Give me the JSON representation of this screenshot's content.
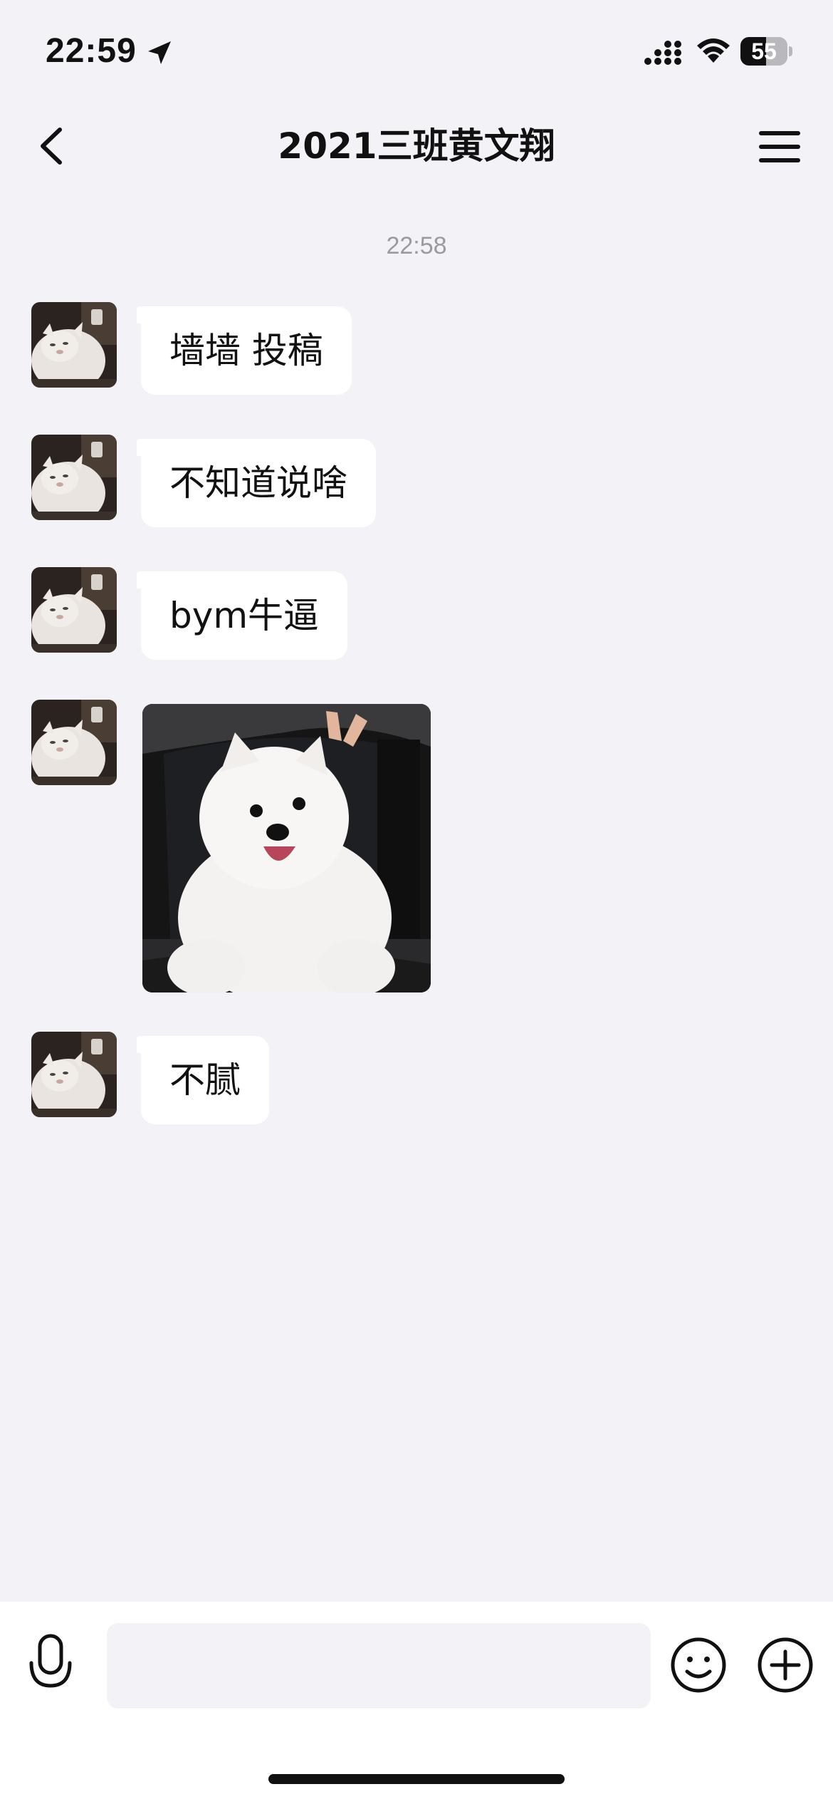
{
  "status_bar": {
    "time": "22:59",
    "battery_percent": 55,
    "battery_label": "55",
    "icons": [
      "location-arrow-icon",
      "cellular-signal-icon",
      "wifi-icon",
      "battery-icon"
    ]
  },
  "nav": {
    "title": "2021三班黄文翔",
    "back_icon": "chevron-left-icon",
    "menu_icon": "hamburger-menu-icon"
  },
  "conversation": {
    "timestamp": "22:58",
    "messages": [
      {
        "type": "text",
        "text": "墙墙 投稿"
      },
      {
        "type": "text",
        "text": "不知道说啥"
      },
      {
        "type": "text",
        "text": "bym牛逼"
      },
      {
        "type": "image",
        "subject": "white puppy in car window"
      },
      {
        "type": "text",
        "text": "不腻"
      }
    ]
  },
  "input_bar": {
    "message_value": "",
    "icons": [
      "microphone-icon",
      "emoji-smile-icon",
      "plus-circle-icon"
    ]
  },
  "colors": {
    "background": "#f3f3f7",
    "bubble": "#ffffff",
    "timestamp": "#9a9a9f",
    "text": "#111111"
  }
}
